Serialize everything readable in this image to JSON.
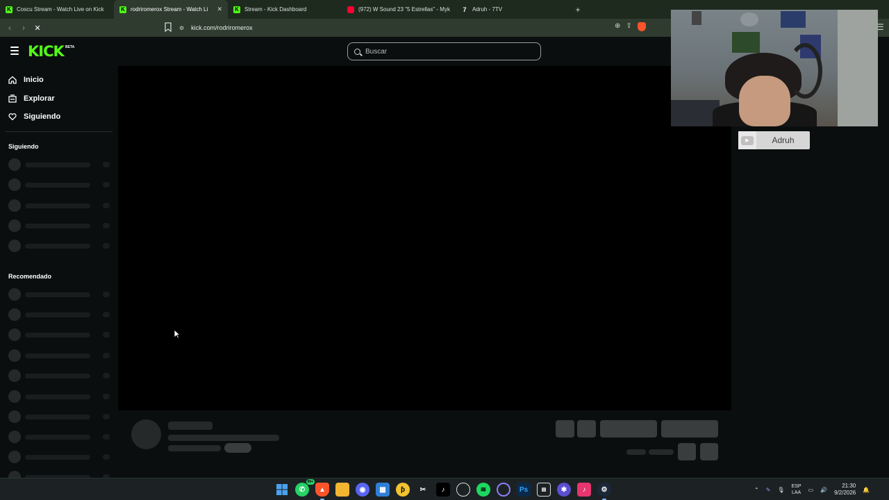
{
  "browser": {
    "tabs": [
      {
        "label": "Coscu Stream - Watch Live on Kick",
        "icon": "kick-icon",
        "active": false
      },
      {
        "label": "rodriromerox Stream - Watch Li",
        "icon": "kick-icon",
        "active": true
      },
      {
        "label": "Stream - Kick Dashboard",
        "icon": "kick-icon",
        "active": false
      },
      {
        "label": "(972) W Sound 23 \"5 Estrellas\" - Myk",
        "icon": "youtube-icon",
        "active": false
      },
      {
        "label": "Adruh - 7TV",
        "icon": "7tv-icon",
        "active": false
      }
    ],
    "new_tab": "+",
    "url": "kick.com/rodriromerox"
  },
  "kick": {
    "logo": "KICK",
    "logo_badge": "BETA",
    "search_placeholder": "Buscar",
    "nav": [
      {
        "label": "Inicio",
        "icon": "home-icon"
      },
      {
        "label": "Explorar",
        "icon": "browse-icon"
      },
      {
        "label": "Siguiendo",
        "icon": "heart-icon"
      }
    ],
    "sections": {
      "following": "Siguiendo",
      "recommended": "Recomendado"
    }
  },
  "overlay": {
    "label": "Adruh"
  },
  "taskbar": {
    "whatsapp_badge": "99+",
    "lang_top": "ESP",
    "lang_bottom": "LAA",
    "time": "21:30",
    "date": "9/2/2026"
  },
  "colors": {
    "brand": "#53fc18",
    "background": "#0b0e0f",
    "skeleton": "#26292a"
  }
}
